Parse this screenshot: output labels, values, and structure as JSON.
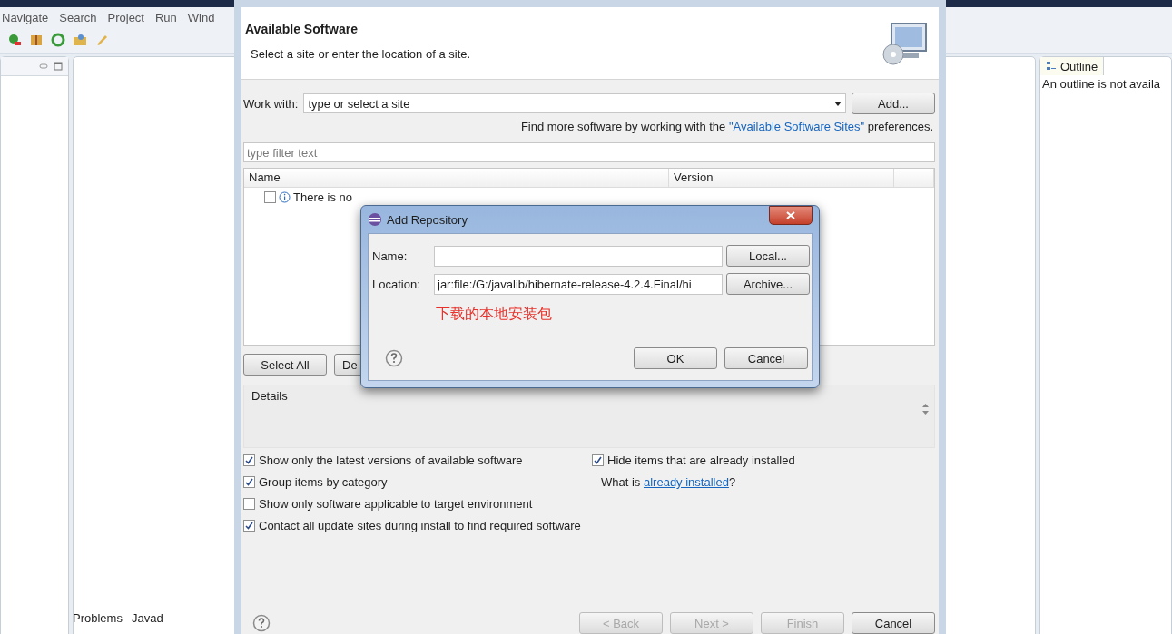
{
  "ide": {
    "menu": [
      "Navigate",
      "Search",
      "Project",
      "Run",
      "Wind"
    ],
    "outline": {
      "tab": "Outline",
      "message": "An outline is not availa"
    },
    "bottom_tabs": [
      "Problems",
      "Javad"
    ]
  },
  "install": {
    "header": {
      "title": "Available Software",
      "subtitle": "Select a site or enter the location of a site."
    },
    "work_with": {
      "label": "Work with:",
      "placeholder": "type or select a site",
      "button": "Add..."
    },
    "find_more": {
      "before": "Find more software by working with the ",
      "link": "\"Available Software Sites\"",
      "after": " preferences."
    },
    "filter": {
      "placeholder": "type filter text"
    },
    "columns": [
      "Name",
      "Version"
    ],
    "rows": [
      {
        "label": "There is no",
        "checked": false
      }
    ],
    "buttons": [
      "Select All",
      "De"
    ],
    "details": {
      "title": "Details"
    },
    "options": [
      {
        "label": "Show only the latest versions of available software",
        "checked": true
      },
      {
        "label": "Group items by category",
        "checked": true
      },
      {
        "label": "Show only software applicable to target environment",
        "checked": false
      },
      {
        "label": "Contact all update sites during install to find required software",
        "checked": true
      }
    ],
    "hide_installed": {
      "label": "Hide items that are already installed",
      "checked": true
    },
    "what_is": {
      "before": "What is ",
      "link": "already installed",
      "after": "?"
    },
    "footer_buttons": [
      {
        "label": "< Back",
        "disabled": true
      },
      {
        "label": "Next >",
        "disabled": true
      },
      {
        "label": "Finish",
        "disabled": true
      },
      {
        "label": "Cancel",
        "disabled": false
      }
    ]
  },
  "add_repository": {
    "title": "Add Repository",
    "name": {
      "label": "Name:"
    },
    "location": {
      "label": "Location:",
      "value": "jar:file:/G:/javalib/hibernate-release-4.2.4.Final/hi"
    },
    "local_button": "Local...",
    "archive_button": "Archive...",
    "annotation": "下载的本地安装包",
    "buttons": [
      "OK",
      "Cancel"
    ]
  }
}
